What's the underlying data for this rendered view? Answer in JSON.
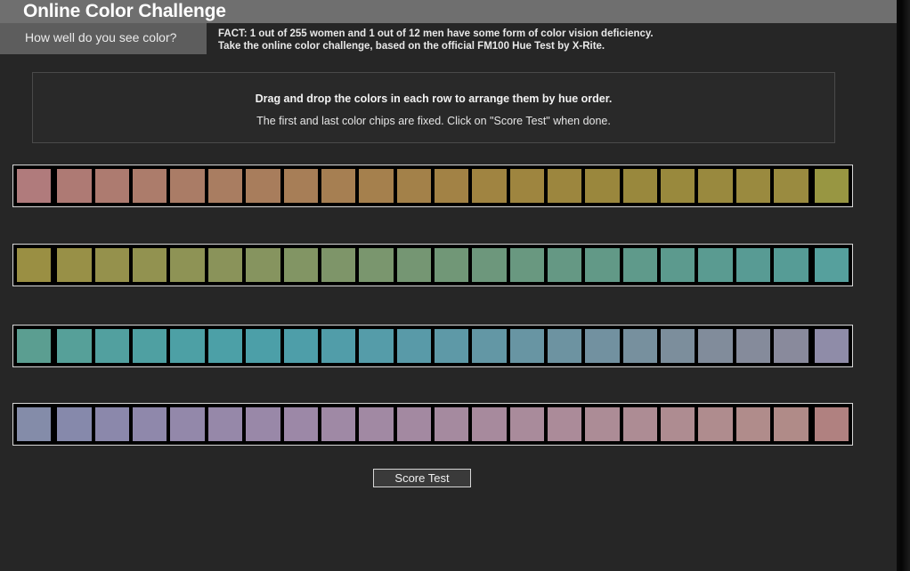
{
  "header": {
    "title": "Online Color Challenge",
    "tagline": "How well do you see color?",
    "fact_line_1": "FACT: 1 out of 255 women and 1 out of 12 men have some form of color vision deficiency.",
    "fact_line_2": "Take the online color challenge, based on the official FM100 Hue Test by X-Rite."
  },
  "instructions": {
    "primary": "Drag and drop the colors in each row to arrange them by hue order.",
    "secondary": "The first and last color chips are fixed. Click on \"Score Test\" when done."
  },
  "actions": {
    "score_test_label": "Score Test"
  },
  "colors": {
    "page_background": "#262626",
    "header_bar": "#6f6f6f",
    "tagline_box": "#5d5d5d",
    "panel_border": "#4a4a4a",
    "row_border": "#d8d8d8",
    "chip_border": "#000000",
    "button_background": "#3a3a3a",
    "button_border": "#d6d6d6",
    "text_primary": "#f2f2f2"
  },
  "rows": [
    {
      "id": "row-1",
      "name": "hue-row-1",
      "chip_count": 22,
      "fixed_first_index": 0,
      "fixed_last_index": 21,
      "chips": [
        "#b07b7c",
        "#ae7a74",
        "#ad7b70",
        "#ac7c6b",
        "#aa7c66",
        "#a97d61",
        "#a87d5c",
        "#a77e57",
        "#a67f52",
        "#a5804d",
        "#a38149",
        "#a28245",
        "#a08441",
        "#9e853f",
        "#9c863e",
        "#9a873d",
        "#99883d",
        "#99893d",
        "#99893e",
        "#9a8a3f",
        "#9a8b40",
        "#989642"
      ]
    },
    {
      "id": "row-2",
      "name": "hue-row-2",
      "chip_count": 22,
      "fixed_first_index": 0,
      "fixed_last_index": 21,
      "chips": [
        "#9a8f43",
        "#989047",
        "#95914c",
        "#929250",
        "#8e9355",
        "#8a935a",
        "#86945f",
        "#829564",
        "#7e9569",
        "#7a966e",
        "#759673",
        "#719777",
        "#6d977c",
        "#699880",
        "#659884",
        "#629987",
        "#5f9a8b",
        "#5c9a8e",
        "#5a9b91",
        "#589b94",
        "#569c96",
        "#56a09d"
      ]
    },
    {
      "id": "row-3",
      "name": "hue-row-3",
      "chip_count": 22,
      "fixed_first_index": 0,
      "fixed_last_index": 21,
      "chips": [
        "#5b9e91",
        "#56a099",
        "#52a09f",
        "#4fa0a2",
        "#4da0a5",
        "#4ca0a7",
        "#4c9fa8",
        "#4e9ea9",
        "#519da9",
        "#559ca9",
        "#599aa8",
        "#5e99a7",
        "#6397a5",
        "#6895a3",
        "#6d93a1",
        "#7291a0",
        "#77909e",
        "#7c8e9c",
        "#818c9b",
        "#858b9b",
        "#898a9c",
        "#8f8ca8"
      ]
    },
    {
      "id": "row-4",
      "name": "hue-row-4",
      "chip_count": 22,
      "fixed_first_index": 0,
      "fixed_last_index": 21,
      "chips": [
        "#848ca9",
        "#8689ab",
        "#8b88ab",
        "#8f88ab",
        "#9388aa",
        "#9688a9",
        "#9988a8",
        "#9c88a7",
        "#9f89a5",
        "#a189a3",
        "#a389a1",
        "#a58a9f",
        "#a78a9d",
        "#a98b9b",
        "#ab8b99",
        "#ac8c96",
        "#ad8c94",
        "#ae8c91",
        "#af8c8e",
        "#b08c8b",
        "#b08b88",
        "#b08180"
      ]
    }
  ]
}
